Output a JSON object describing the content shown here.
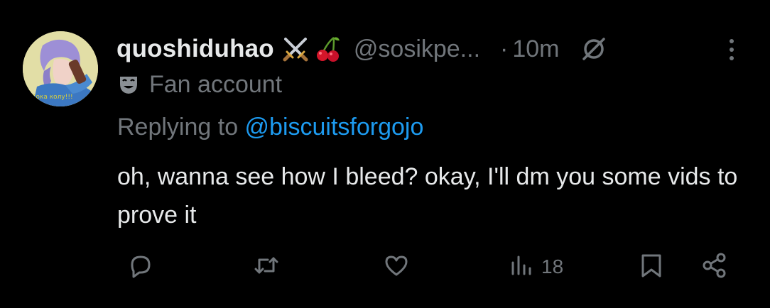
{
  "tweet": {
    "display_name": "quoshiduhao",
    "name_emojis": [
      "crossed-swords-icon",
      "cherries-icon"
    ],
    "handle": "@sosikpe...",
    "separator": "·",
    "time": "10m",
    "label_icon": "theater-masks-icon",
    "label": "Fan account",
    "replying_prefix": "Replying to ",
    "replying_to": "@biscuitsforgojo",
    "text": "oh, wanna see how I bleed? okay, I'll dm you some vids to prove it",
    "avatar_caption": "Кока колу!!!"
  },
  "actions": {
    "reply_icon": "reply-icon",
    "retweet_icon": "retweet-icon",
    "like_icon": "like-icon",
    "views_icon": "views-icon",
    "views_count": "18",
    "bookmark_icon": "bookmark-icon",
    "share_icon": "share-icon"
  },
  "colors": {
    "background": "#000000",
    "primary_text": "#e7e9ea",
    "secondary_text": "#71767b",
    "link": "#1d9bf0"
  }
}
